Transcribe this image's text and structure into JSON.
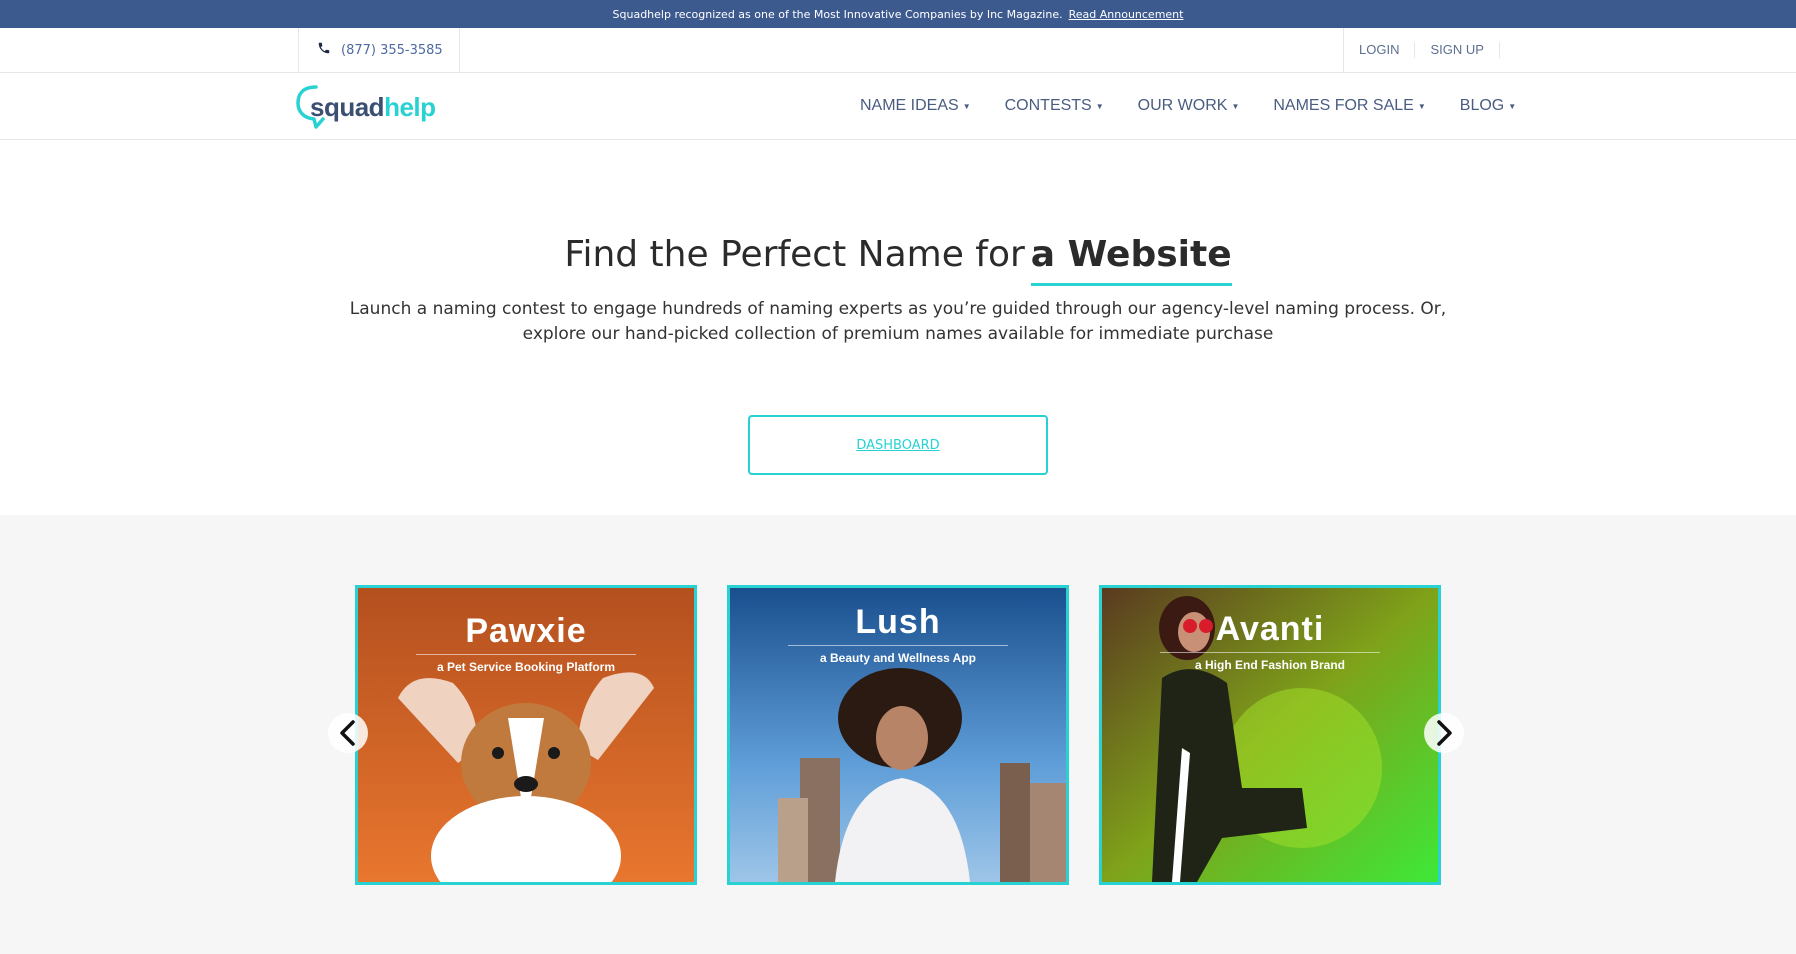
{
  "announcement": {
    "text": "Squadhelp recognized as one of the Most Innovative Companies by Inc Magazine.",
    "link": "Read Announcement"
  },
  "topbar": {
    "phone": "(877) 355-3585",
    "login": "LOGIN",
    "signup": "SIGN UP"
  },
  "logo": {
    "part1": "squad",
    "part2": "help"
  },
  "nav": {
    "items": [
      {
        "label": "NAME IDEAS"
      },
      {
        "label": "CONTESTS"
      },
      {
        "label": "OUR WORK"
      },
      {
        "label": "NAMES FOR SALE"
      },
      {
        "label": "BLOG"
      }
    ]
  },
  "hero": {
    "title_lead": "Find the Perfect Name for",
    "title_highlight": "a Website",
    "subtitle": "Launch a naming contest to engage hundreds of naming experts as you’re guided through our agency-level naming process. Or, explore our hand-picked collection of premium names available for immediate purchase",
    "button": "DASHBOARD"
  },
  "showcase": {
    "cards": [
      {
        "name": "Pawxie",
        "tagline": "a Pet Service Booking Platform"
      },
      {
        "name": "Lush",
        "tagline": "a Beauty and Wellness App"
      },
      {
        "name": "Avanti",
        "tagline": "a High End Fashion Brand"
      }
    ]
  },
  "colors": {
    "accent": "#28d2d2",
    "announce_bg": "#3d5a8f",
    "nav_text": "#4a5c80",
    "showcase_bg": "#f6f6f6"
  },
  "icons": [
    "phone-icon",
    "caret-down-icon",
    "chevron-left-icon",
    "chevron-right-icon"
  ]
}
